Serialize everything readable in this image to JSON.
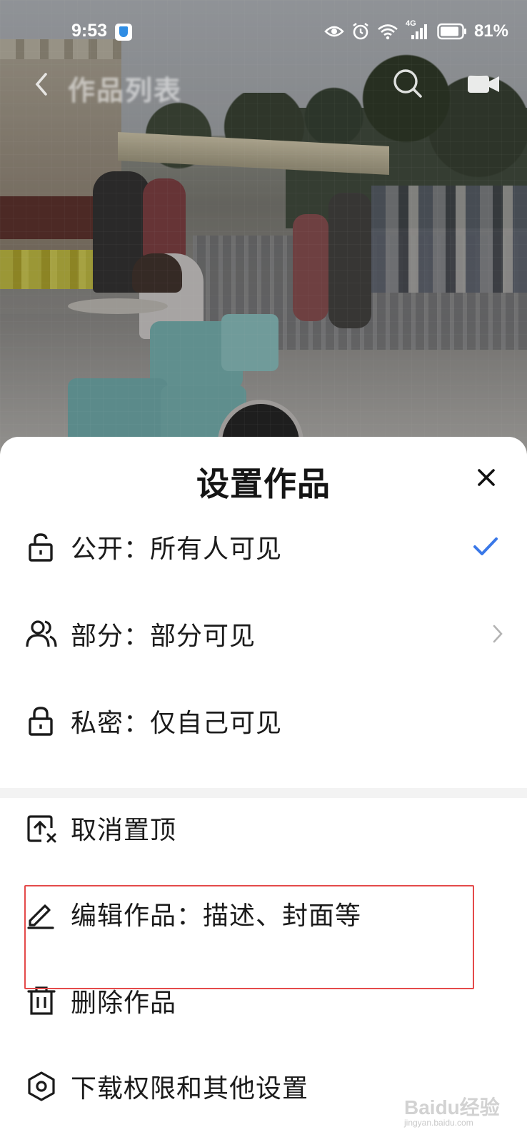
{
  "status_bar": {
    "time": "9:53",
    "network": "4G",
    "battery_percent": "81%"
  },
  "nav": {
    "back_icon": "chevron-left-icon",
    "title": "作品列表",
    "search_icon": "search-icon",
    "camera_icon": "camera-icon"
  },
  "sheet": {
    "title": "设置作品",
    "close_icon": "close-icon",
    "visibility_options": [
      {
        "icon": "unlock-icon",
        "label": "公开：所有人可见",
        "selected": true,
        "accessory": "check-icon"
      },
      {
        "icon": "users-icon",
        "label": "部分：部分可见",
        "selected": false,
        "accessory": "chevron-right-icon"
      },
      {
        "icon": "lock-icon",
        "label": "私密：仅自己可见",
        "selected": false,
        "accessory": ""
      }
    ],
    "actions": [
      {
        "icon": "unpin-icon",
        "label": "取消置顶"
      },
      {
        "icon": "edit-icon",
        "label": "编辑作品：描述、封面等",
        "highlighted": true
      },
      {
        "icon": "trash-icon",
        "label": "删除作品"
      },
      {
        "icon": "settings-hexagon-icon",
        "label": "下载权限和其他设置"
      }
    ],
    "accent_color": "#3a78e8",
    "highlight_color": "#e44a4a"
  },
  "watermark": {
    "brand": "Baidu经验",
    "url": "jingyan.baidu.com"
  }
}
